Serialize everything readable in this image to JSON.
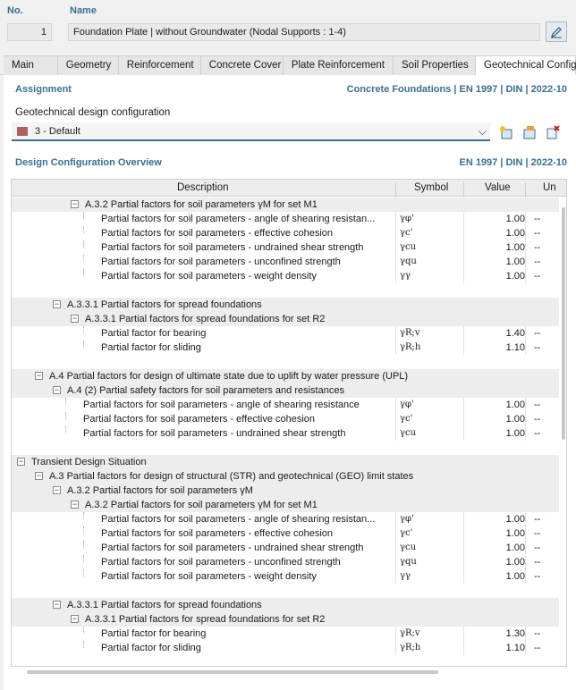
{
  "header": {
    "no_label": "No.",
    "no_value": "1",
    "name_label": "Name",
    "name_value": "Foundation Plate | without Groundwater (Nodal Supports : 1-4)"
  },
  "tabs": [
    "Main",
    "Geometry",
    "Reinforcement",
    "Concrete Cover",
    "Plate Reinforcement",
    "Soil Properties",
    "Geotechnical Configu"
  ],
  "active_tab": "Geotechnical Configu",
  "assignment": {
    "title": "Assignment",
    "right": "Concrete Foundations | EN 1997 | DIN | 2022-10",
    "config_label": "Geotechnical design configuration",
    "config_value": "3 - Default",
    "config_color": "#b06060"
  },
  "overview": {
    "title": "Design Configuration Overview",
    "right": "EN 1997 | DIN | 2022-10",
    "columns": [
      "Description",
      "Symbol",
      "Value",
      "Un"
    ]
  },
  "rows": [
    {
      "t": "A.3.2 Partial factors for soil parameters γM for set M1",
      "lvl": 3,
      "grp": true,
      "toggle": true
    },
    {
      "t": "Partial factors for soil parameters - angle of shearing resistan...",
      "lvl": 4,
      "s": "γφ'",
      "v": "1.00",
      "u": "--"
    },
    {
      "t": "Partial factors for soil parameters - effective cohesion",
      "lvl": 4,
      "s": "γc'",
      "v": "1.00",
      "u": "--"
    },
    {
      "t": "Partial factors for soil parameters - undrained shear strength",
      "lvl": 4,
      "s": "γcu",
      "v": "1.00",
      "u": "--"
    },
    {
      "t": "Partial factors for soil parameters - unconfined strength",
      "lvl": 4,
      "s": "γqu",
      "v": "1.00",
      "u": "--"
    },
    {
      "t": "Partial factors for soil parameters - weight density",
      "lvl": 4,
      "s": "γγ",
      "v": "1.00",
      "u": "--"
    },
    {
      "t": "",
      "blank": true
    },
    {
      "t": "A.3.3.1 Partial factors for spread foundations",
      "lvl": 2,
      "grp": true,
      "toggle": true
    },
    {
      "t": "A.3.3.1 Partial factors for spread foundations for set R2",
      "lvl": 3,
      "grp": true,
      "toggle": true
    },
    {
      "t": "Partial factor for bearing",
      "lvl": 4,
      "s": "γR;v",
      "v": "1.40",
      "u": "--"
    },
    {
      "t": "Partial factor for sliding",
      "lvl": 4,
      "s": "γR;h",
      "v": "1.10",
      "u": "--"
    },
    {
      "t": "",
      "blank": true
    },
    {
      "t": "A.4 Partial factors for design of ultimate state due to uplift by water pressure (UPL)",
      "lvl": 1,
      "grp": true,
      "toggle": true
    },
    {
      "t": "A.4 (2) Partial safety factors for soil parameters and resistances",
      "lvl": 2,
      "grp": true,
      "toggle": true
    },
    {
      "t": "Partial factors for soil parameters - angle of shearing resistance",
      "lvl": 3,
      "s": "γφ'",
      "v": "1.00",
      "u": "--"
    },
    {
      "t": "Partial factors for soil parameters - effective cohesion",
      "lvl": 3,
      "s": "γc'",
      "v": "1.00",
      "u": "--"
    },
    {
      "t": "Partial factors for soil parameters - undrained shear strength",
      "lvl": 3,
      "s": "γcu",
      "v": "1.00",
      "u": "--"
    },
    {
      "t": "",
      "blank": true
    },
    {
      "t": "Transient Design Situation",
      "lvl": 0,
      "grp": true,
      "toggle": true
    },
    {
      "t": "A.3 Partial factors for design of structural (STR) and geotechnical (GEO) limit states",
      "lvl": 1,
      "grp": true,
      "toggle": true
    },
    {
      "t": "A.3.2 Partial factors for soil parameters γM",
      "lvl": 2,
      "grp": true,
      "toggle": true
    },
    {
      "t": "A.3.2 Partial factors for soil parameters γM for set M1",
      "lvl": 3,
      "grp": true,
      "toggle": true
    },
    {
      "t": "Partial factors for soil parameters - angle of shearing resistan...",
      "lvl": 4,
      "s": "γφ'",
      "v": "1.00",
      "u": "--"
    },
    {
      "t": "Partial factors for soil parameters - effective cohesion",
      "lvl": 4,
      "s": "γc'",
      "v": "1.00",
      "u": "--"
    },
    {
      "t": "Partial factors for soil parameters - undrained shear strength",
      "lvl": 4,
      "s": "γcu",
      "v": "1.00",
      "u": "--"
    },
    {
      "t": "Partial factors for soil parameters - unconfined strength",
      "lvl": 4,
      "s": "γqu",
      "v": "1.00",
      "u": "--"
    },
    {
      "t": "Partial factors for soil parameters - weight density",
      "lvl": 4,
      "s": "γγ",
      "v": "1.00",
      "u": "--"
    },
    {
      "t": "",
      "blank": true
    },
    {
      "t": "A.3.3.1 Partial factors for spread foundations",
      "lvl": 2,
      "grp": true,
      "toggle": true
    },
    {
      "t": "A.3.3.1 Partial factors for spread foundations for set R2",
      "lvl": 3,
      "grp": true,
      "toggle": true
    },
    {
      "t": "Partial factor for bearing",
      "lvl": 4,
      "s": "γR;v",
      "v": "1.30",
      "u": "--"
    },
    {
      "t": "Partial factor for sliding",
      "lvl": 4,
      "s": "γR;h",
      "v": "1.10",
      "u": "--"
    }
  ]
}
